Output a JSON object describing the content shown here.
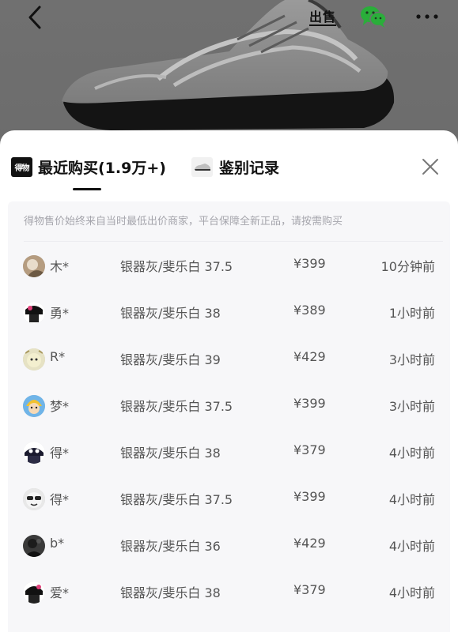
{
  "header": {
    "sell_label": "出售"
  },
  "tabs": [
    {
      "label": "最近购买(1.9万+)",
      "active": true
    },
    {
      "label": "鉴别记录",
      "active": false
    }
  ],
  "brand_logo_text": "得物",
  "notice": "得物售价始终来自当时最低出价商家，平台保障全新正品，请按需购买",
  "purchases": [
    {
      "user": "木*",
      "spec": "银器灰/斐乐白 37.5",
      "price": "¥399",
      "time": "10分钟前"
    },
    {
      "user": "勇*",
      "spec": "银器灰/斐乐白 38",
      "price": "¥389",
      "time": "1小时前"
    },
    {
      "user": "R*",
      "spec": "银器灰/斐乐白 39",
      "price": "¥429",
      "time": "3小时前"
    },
    {
      "user": "梦*",
      "spec": "银器灰/斐乐白 37.5",
      "price": "¥399",
      "time": "3小时前"
    },
    {
      "user": "得*",
      "spec": "银器灰/斐乐白 38",
      "price": "¥379",
      "time": "4小时前"
    },
    {
      "user": "得*",
      "spec": "银器灰/斐乐白 37.5",
      "price": "¥399",
      "time": "4小时前"
    },
    {
      "user": "b*",
      "spec": "银器灰/斐乐白 36",
      "price": "¥429",
      "time": "4小时前"
    },
    {
      "user": "爱*",
      "spec": "银器灰/斐乐白 38",
      "price": "¥379",
      "time": "4小时前"
    }
  ],
  "icons": {
    "back": "back-arrow-icon",
    "wechat": "wechat-icon",
    "more": "more-icon",
    "close": "close-icon"
  },
  "colors": {
    "overlay": "#6f6f6f",
    "sheet": "#ffffff",
    "panel": "#f7f7f9",
    "text_muted": "#a5a5ac",
    "wechat": "#2aae3a"
  }
}
